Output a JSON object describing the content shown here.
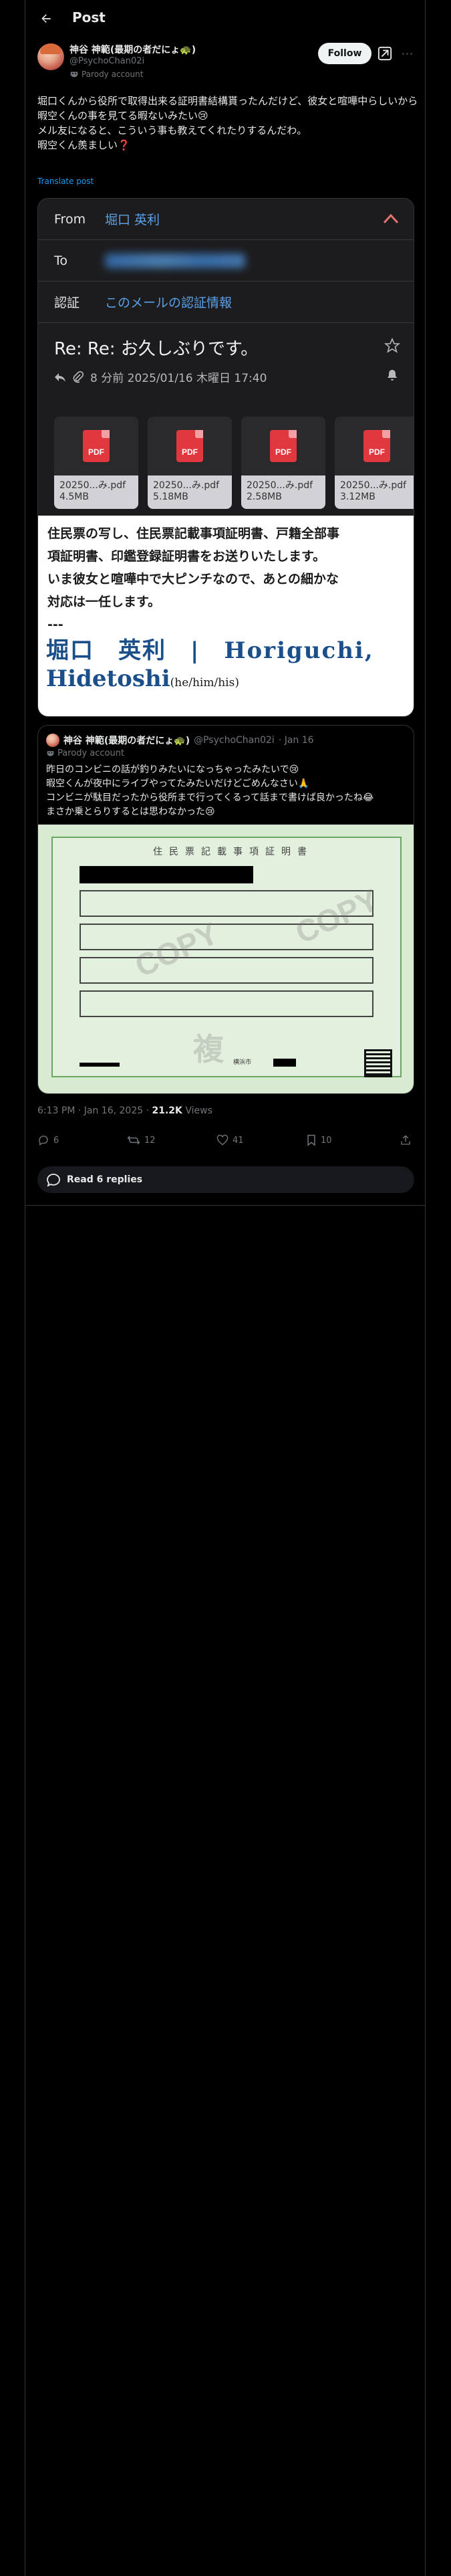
{
  "header": {
    "title": "Post"
  },
  "author": {
    "name": "神谷 神範(最期の者だにょ🐢)",
    "handle": "@PsychoChan02i",
    "parody_label": "Parody account",
    "follow_label": "Follow",
    "more_label": "···"
  },
  "tweet": {
    "lines": [
      "堀口くんから役所で取得出来る証明書結構貰ったんだけど、彼女と喧嘩中らしいから暇空くんの事を見てる暇ないみたい😢",
      "メル友になると、こういう事も教えてくれたりするんだわ。",
      "",
      "暇空くん羨ましい❓"
    ],
    "translate_label": "Translate post"
  },
  "email": {
    "from_label": "From",
    "from_value": "堀口 英利",
    "to_label": "To",
    "auth_label": "認証",
    "auth_value": "このメールの認証情報",
    "subject": "Re: Re: お久しぶりです。",
    "meta": "8 分前 2025/01/16 木曜日 17:40",
    "attachments": [
      {
        "name": "20250...み.pdf",
        "size": "4.5MB",
        "icon": "PDF"
      },
      {
        "name": "20250...み.pdf",
        "size": "5.18MB",
        "icon": "PDF"
      },
      {
        "name": "20250...み.pdf",
        "size": "2.58MB",
        "icon": "PDF"
      },
      {
        "name": "20250...み.pdf",
        "size": "3.12MB",
        "icon": "PDF"
      }
    ],
    "body_lines": [
      "住民票の写し、住民票記載事項証明書、戸籍全部事",
      "項証明書、印鑑登録証明書をお送りいたします。",
      "",
      "いま彼女と喧嘩中で大ピンチなので、あとの細かな",
      "対応は一任します。",
      "---"
    ],
    "signature_line1": "堀口　英利　|　Horiguchi,",
    "signature_line2": "Hidetoshi",
    "signature_pronouns": "(he/him/his)"
  },
  "quote": {
    "name": "神谷 神範(最期の者だにょ🐢)",
    "handle": "@PsychoChan02i",
    "date": "· Jan 16",
    "parody_label": "Parody account",
    "lines": [
      "昨日のコンビニの話が釣りみたいになっちゃったみたいで😢",
      "暇空くんが夜中にライブやってたみたいだけどごめんなさい🙏",
      "コンビニが駄目だったから役所まで行ってくるって話まで書けば良かったね😂",
      "まさか乗とらりするとは思わなかった😢"
    ],
    "doc_title": "住民票記載事項証明書",
    "watermark_1": "COPY",
    "watermark_2": "複",
    "doc_city": "横浜市"
  },
  "stats": {
    "time": "6:13 PM · Jan 16, 2025 · ",
    "views_count": "21.2K",
    "views_label": " Views",
    "replies": "6",
    "reposts": "12",
    "likes": "41",
    "bookmarks": "10"
  },
  "read_replies_label": "Read 6 replies"
}
